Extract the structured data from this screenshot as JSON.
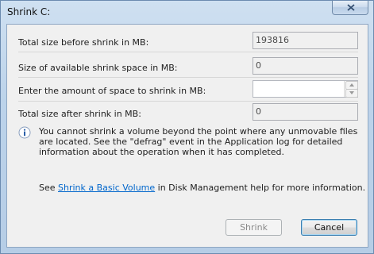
{
  "window": {
    "title": "Shrink C:"
  },
  "form": {
    "total_before_label": "Total size before shrink in MB:",
    "total_before_value": "193816",
    "available_label": "Size of available shrink space in MB:",
    "available_value": "0",
    "amount_label": "Enter the amount of space to shrink in MB:",
    "amount_value": "",
    "total_after_label": "Total size after shrink in MB:",
    "total_after_value": "0"
  },
  "info": {
    "text": "You cannot shrink a volume beyond the point where any unmovable files are located. See the \"defrag\" event in the Application log for detailed information about the operation when it has completed.",
    "see_prefix": "See ",
    "link_text": "Shrink a Basic Volume",
    "see_suffix": " in Disk Management help for more information."
  },
  "buttons": {
    "shrink": "Shrink",
    "cancel": "Cancel"
  },
  "icons": {
    "info": "info-icon",
    "close": "close-icon",
    "spin_up": "spin-up-arrow-icon",
    "spin_down": "spin-down-arrow-icon"
  }
}
